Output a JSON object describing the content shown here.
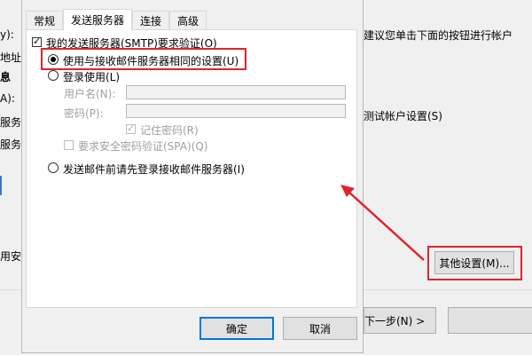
{
  "background": {
    "frag_1": "y):",
    "frag_2": "建议您单击下面的按钮进行帐户",
    "frag_3": "息",
    "frag_4": "地址",
    "frag_5": "A):",
    "frag_6": "服务",
    "frag_7": "测试帐户设置(S)",
    "frag_8": "服务",
    "frag_9": "用安",
    "more_settings_button": "其他设置(M)...",
    "next_button": "下一步(N) >"
  },
  "dialog": {
    "tabs": [
      "常规",
      "发送服务器",
      "连接",
      "高级"
    ],
    "active_tab": 1,
    "smtp_auth_label": "我的发送服务器(SMTP)要求验证(O)",
    "use_same_settings_label": "使用与接收邮件服务器相同的设置(U)",
    "login_using_label": "登录使用(L)",
    "username_label": "用户名(N):",
    "username_value": "",
    "password_label": "密码(P):",
    "password_value": "",
    "remember_password_label": "记住密码(R)",
    "require_spa_label": "要求安全密码验证(SPA)(Q)",
    "login_before_send_label": "发送邮件前请先登录接收邮件服务器(I)",
    "ok_button": "确定",
    "cancel_button": "取消"
  },
  "colors": {
    "highlight": "#e0242a",
    "default_button_border": "#0078d7"
  }
}
